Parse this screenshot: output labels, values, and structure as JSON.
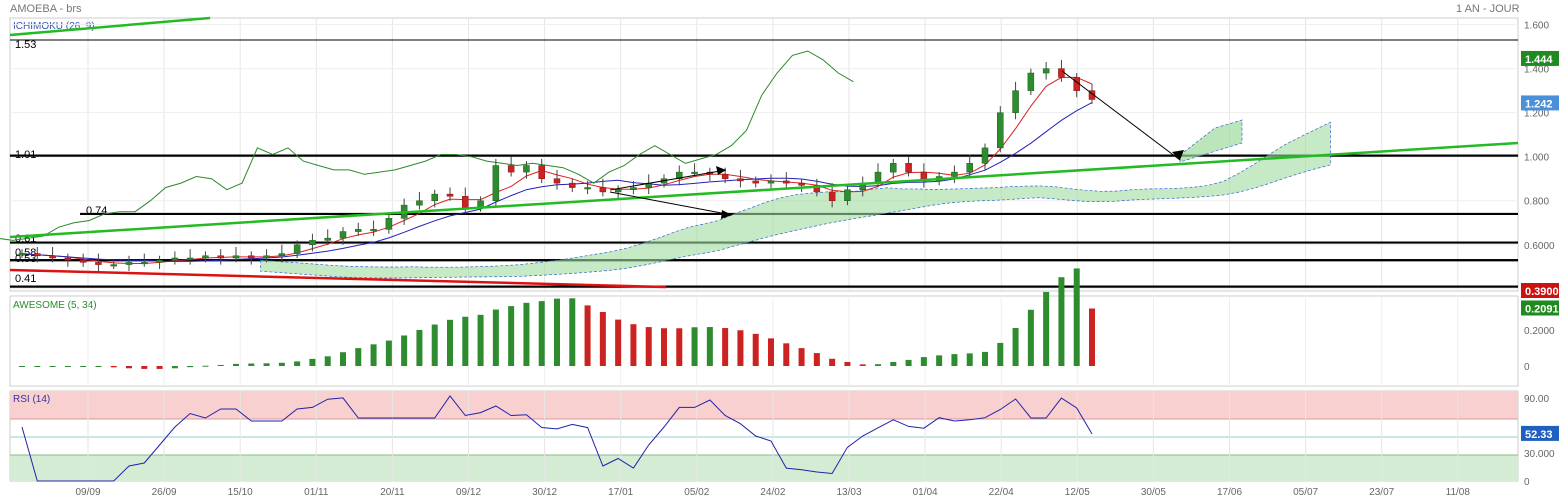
{
  "header": {
    "left_title": "AMOEBA - brs",
    "right_title": "1 AN - JOUR"
  },
  "main_panel": {
    "indicator_label": "ICHIMOKU (26, 9)",
    "price_axis_ticks": [
      "1.600",
      "1.400",
      "1.200",
      "1.000",
      "0.800",
      "0.6000",
      "0.4000"
    ],
    "price_badges": [
      {
        "label": "1.444",
        "value": 1.444,
        "color": "#1f8a1f"
      },
      {
        "label": "1.242",
        "value": 1.242,
        "color": "#4a90d9"
      },
      {
        "label": "0.3900",
        "value": 0.39,
        "color": "#cc1111"
      }
    ],
    "horizontal_levels": [
      {
        "label": "1.53",
        "value": 1.53,
        "weight": "thin"
      },
      {
        "label": "1.01",
        "value": 1.005,
        "weight": "bold"
      },
      {
        "label": "0.74",
        "value": 0.74,
        "weight": "bold"
      },
      {
        "label": "0.61",
        "value": 0.61,
        "weight": "bold"
      },
      {
        "label": "0.58",
        "value": 0.53,
        "weight": "bold"
      },
      {
        "label": "0.53",
        "value": 0.53,
        "weight": "bold"
      },
      {
        "label": "0.41",
        "value": 0.41,
        "weight": "bold"
      }
    ]
  },
  "awesome_panel": {
    "indicator_label": "AWESOME (5, 34)",
    "axis_ticks": [
      "0.2000",
      "0"
    ],
    "badge": {
      "label": "0.2091",
      "value": 0.2091,
      "color": "#1f8a1f"
    }
  },
  "rsi_panel": {
    "indicator_label": "RSI (14)",
    "axis_ticks": [
      "90.00",
      "30.000",
      "0"
    ],
    "badge": {
      "label": "52.33",
      "value": 52.33,
      "color": "#1f5fbf"
    }
  },
  "x_axis": {
    "ticks": [
      "09/09",
      "26/09",
      "15/10",
      "01/11",
      "20/11",
      "09/12",
      "30/12",
      "17/01",
      "05/02",
      "24/02",
      "13/03",
      "01/04",
      "22/04",
      "12/05",
      "30/05",
      "17/06",
      "05/07",
      "23/07",
      "11/08"
    ]
  },
  "chart_data": {
    "type": "candlestick",
    "title": "AMOEBA - brs",
    "period": "1 AN - JOUR",
    "y_range": [
      0.39,
      1.63
    ],
    "close_series_approx": [
      0.56,
      0.55,
      0.54,
      0.53,
      0.52,
      0.51,
      0.51,
      0.52,
      0.52,
      0.53,
      0.54,
      0.54,
      0.55,
      0.54,
      0.55,
      0.54,
      0.55,
      0.56,
      0.6,
      0.62,
      0.63,
      0.66,
      0.67,
      0.67,
      0.72,
      0.78,
      0.8,
      0.83,
      0.82,
      0.77,
      0.8,
      0.96,
      0.93,
      0.96,
      0.9,
      0.88,
      0.86,
      0.86,
      0.84,
      0.85,
      0.86,
      0.88,
      0.9,
      0.93,
      0.93,
      0.92,
      0.9,
      0.89,
      0.88,
      0.89,
      0.88,
      0.87,
      0.84,
      0.8,
      0.85,
      0.88,
      0.93,
      0.97,
      0.93,
      0.89,
      0.91,
      0.93,
      0.97,
      1.04,
      1.2,
      1.3,
      1.38,
      1.4,
      1.36,
      1.3,
      1.26
    ],
    "last_close": 1.242,
    "high_marker": 1.444,
    "awesome_last": 0.2091,
    "rsi_last": 52.33
  }
}
